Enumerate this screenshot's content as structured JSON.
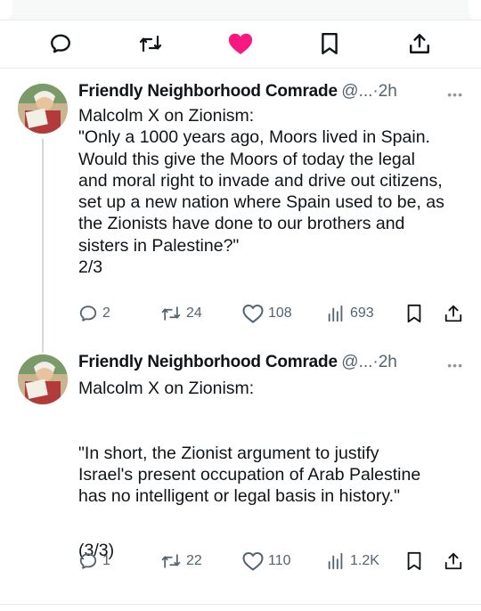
{
  "top_actions": {
    "icons": [
      "reply-icon",
      "retweet-icon",
      "like-icon-filled",
      "bookmark-icon",
      "share-icon"
    ],
    "like_color": "#f91880"
  },
  "tweets": [
    {
      "name": "Friendly Neighborhood Comrade",
      "handle": "@...",
      "sep": "·",
      "time": "2h",
      "more": "•••",
      "lines": [
        "Malcolm X on Zionism:",
        "\"Only a 1000 years ago, Moors lived in Spain.",
        "Would this give the Moors of today the legal",
        "and moral right to invade and drive out citizens,",
        "set up a new nation where Spain used to be, as",
        "the Zionists have done to our brothers and",
        "sisters in Palestine?\"",
        "2/3"
      ],
      "replies": "2",
      "retweets": "24",
      "likes": "108",
      "views": "693"
    },
    {
      "name": "Friendly Neighborhood Comrade",
      "handle": "@...",
      "sep": "·",
      "time": "2h",
      "more": "•••",
      "lines": [
        "Malcolm X on Zionism:",
        "",
        "\"In short, the Zionist argument to justify",
        "Israel's present occupation of Arab Palestine",
        "has no intelligent or legal basis in history.\"",
        "",
        "(3/3)"
      ],
      "replies": "1",
      "retweets": "22",
      "likes": "110",
      "views": "1.2K"
    }
  ],
  "colors": {
    "text": "#0f1419",
    "muted": "#536471",
    "line": "#cfd9de",
    "like": "#f91880"
  }
}
